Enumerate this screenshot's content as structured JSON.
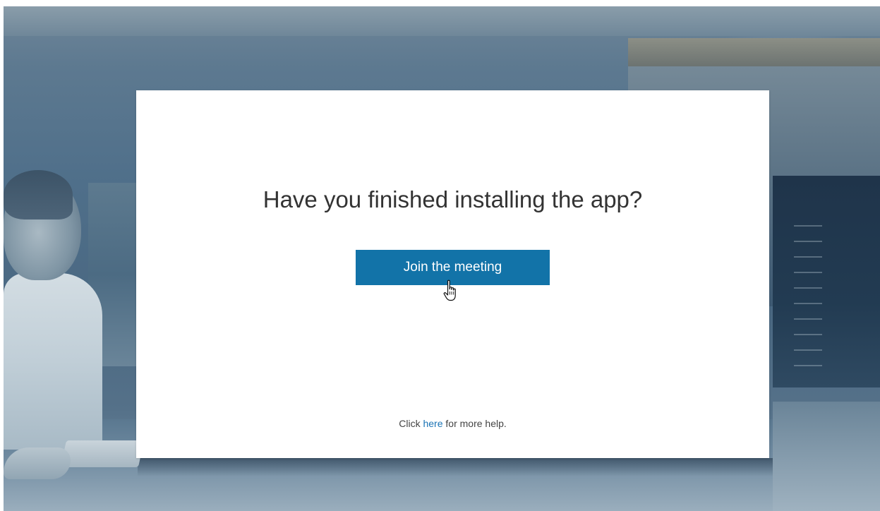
{
  "dialog": {
    "title": "Have you finished installing the app?",
    "join_button_label": "Join the meeting",
    "help_prefix": "Click ",
    "help_link_label": "here",
    "help_suffix": " for more help."
  },
  "icons": {
    "cursor": "hand-pointer-icon"
  },
  "colors": {
    "button_bg": "#1273a8",
    "button_text": "#ffffff",
    "link": "#1a73b5",
    "title_text": "#333333"
  }
}
